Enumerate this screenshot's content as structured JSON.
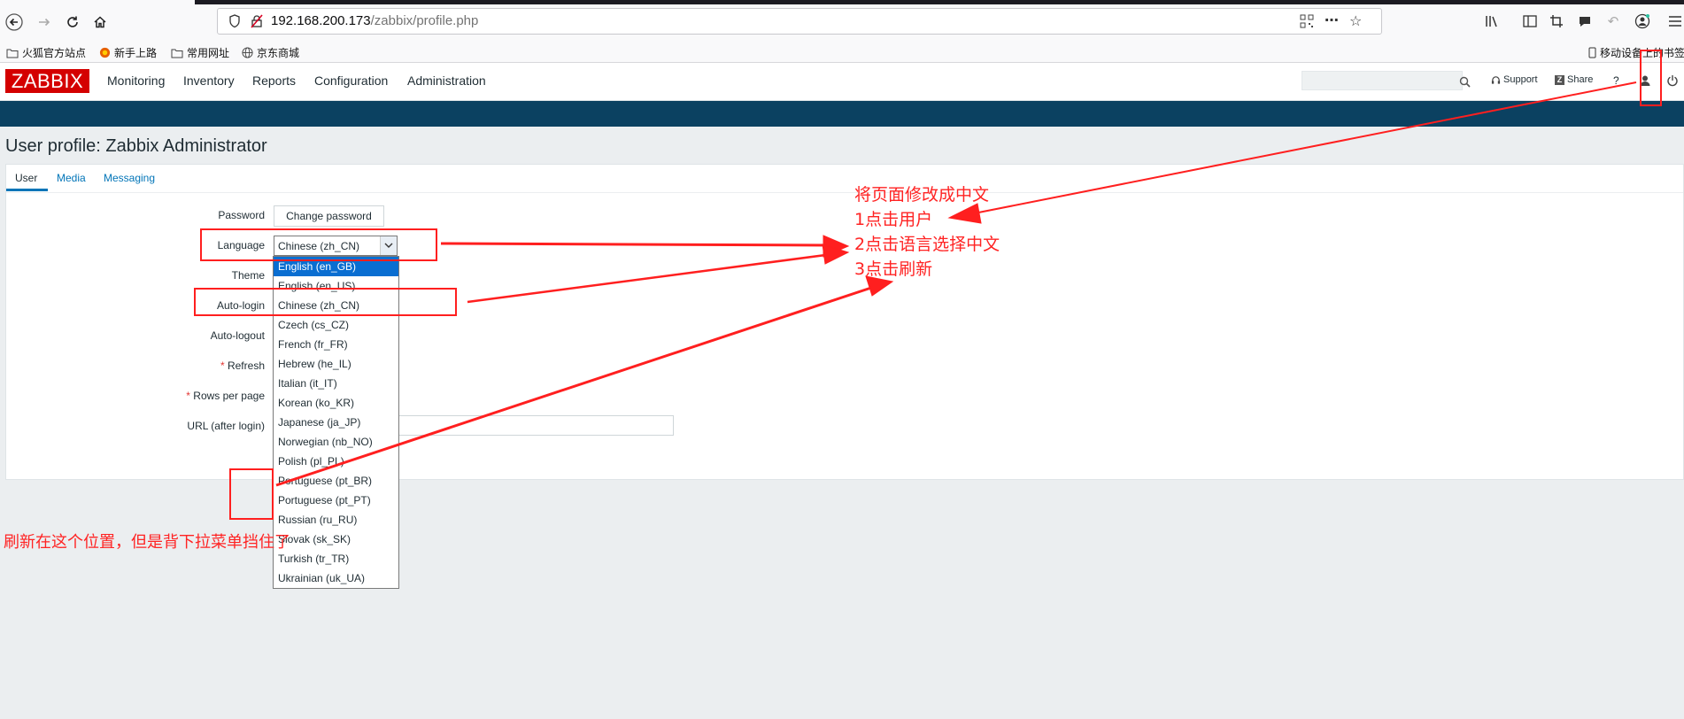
{
  "browser": {
    "url_host": "192.168.200.173",
    "url_path": "/zabbix/profile.php",
    "bookmarks": [
      "火狐官方站点",
      "新手上路",
      "常用网址",
      "京东商城"
    ],
    "mobile_bookmarks": "移动设备上的书签"
  },
  "zabbix": {
    "logo": "ZABBIX",
    "menu": [
      "Monitoring",
      "Inventory",
      "Reports",
      "Configuration",
      "Administration"
    ],
    "search_placeholder": "",
    "support_label": "Support",
    "share_label": "Share",
    "help_label": "?",
    "share_badge": "Z",
    "accent": "#d40000",
    "bar_color": "#0b4161"
  },
  "page": {
    "title": "User profile: Zabbix Administrator",
    "tabs": [
      "User",
      "Media",
      "Messaging"
    ],
    "active_tab": "User"
  },
  "form": {
    "labels": {
      "password": "Password",
      "language": "Language",
      "theme": "Theme",
      "autologin": "Auto-login",
      "autologout": "Auto-logout",
      "refresh": "Refresh",
      "rows_per_page": "Rows per page",
      "url_after_login": "URL (after login)"
    },
    "required_marker": "*",
    "change_password_button": "Change password",
    "language_value": "Chinese (zh_CN)",
    "language_options": [
      "English (en_GB)",
      "English (en_US)",
      "Chinese (zh_CN)",
      "Czech (cs_CZ)",
      "French (fr_FR)",
      "Hebrew (he_IL)",
      "Italian (it_IT)",
      "Korean (ko_KR)",
      "Japanese (ja_JP)",
      "Norwegian (nb_NO)",
      "Polish (pl_PL)",
      "Portuguese (pt_BR)",
      "Portuguese (pt_PT)",
      "Russian (ru_RU)",
      "Slovak (sk_SK)",
      "Turkish (tr_TR)",
      "Ukrainian (uk_UA)"
    ],
    "highlighted_option": "English (en_GB)",
    "url_after_login_value": ""
  },
  "annotations": {
    "color": "#ff1f1f",
    "steps": [
      "将页面修改成中文",
      "1点击用户",
      "2点击语言选择中文",
      "3点击刷新"
    ],
    "bottom_note": "刷新在这个位置，但是背下拉菜单挡住了"
  }
}
